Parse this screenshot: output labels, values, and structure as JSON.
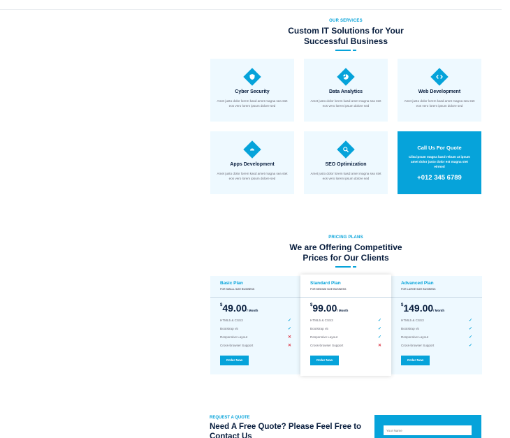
{
  "services": {
    "eyebrow": "OUR SERVICES",
    "heading_line1": "Custom IT Solutions for Your",
    "heading_line2": "Successful Business",
    "items": [
      {
        "title": "Cyber Security",
        "text": "Amet justo dolor lorem kasd amet magna sea stet eos vero lorem ipsum dolore sed",
        "icon": "shield-icon"
      },
      {
        "title": "Data Analytics",
        "text": "Amet justo dolor lorem kasd amet magna sea stet eos vero lorem ipsum dolore sed",
        "icon": "chart-pie-icon"
      },
      {
        "title": "Web Development",
        "text": "Amet justo dolor lorem kasd amet magna sea stet eos vero lorem ipsum dolore sed",
        "icon": "code-icon"
      },
      {
        "title": "Apps Development",
        "text": "Amet justo dolor lorem kasd amet magna sea stet eos vero lorem ipsum dolore sed",
        "icon": "android-icon"
      },
      {
        "title": "SEO Optimization",
        "text": "Amet justo dolor lorem kasd amet magna sea stet eos vero lorem ipsum dolore sed",
        "icon": "search-icon"
      }
    ],
    "quote_card": {
      "title": "Call Us For Quote",
      "text": "Clita ipsum magna kasd rebum at ipsum amet dolor justo dolor est magna stet eirmod",
      "phone": "+012 345 6789"
    }
  },
  "pricing": {
    "eyebrow": "PRICING PLANS",
    "heading_line1": "We are Offering Competitive",
    "heading_line2": "Prices for Our Clients",
    "plans": [
      {
        "name": "Basic Plan",
        "subtitle": "FOR SMALL SIZE BUSINESS",
        "currency": "$",
        "amount": "49.00",
        "period": "/ Month",
        "features": [
          {
            "label": "HTML5 & CSS3",
            "included": true
          },
          {
            "label": "Bootstrap v5",
            "included": true
          },
          {
            "label": "Responsive Layout",
            "included": false
          },
          {
            "label": "Cross-browser Support",
            "included": false
          }
        ],
        "button": "Order Now"
      },
      {
        "name": "Standard Plan",
        "subtitle": "FOR MEDIUM SIZE BUSINESS",
        "currency": "$",
        "amount": "99.00",
        "period": "/ Month",
        "features": [
          {
            "label": "HTML5 & CSS3",
            "included": true
          },
          {
            "label": "Bootstrap v5",
            "included": true
          },
          {
            "label": "Responsive Layout",
            "included": true
          },
          {
            "label": "Cross-browser Support",
            "included": false
          }
        ],
        "button": "Order Now"
      },
      {
        "name": "Advanced Plan",
        "subtitle": "FOR LARGE SIZE BUSINESS",
        "currency": "$",
        "amount": "149.00",
        "period": "/ Month",
        "features": [
          {
            "label": "HTML5 & CSS3",
            "included": true
          },
          {
            "label": "Bootstrap v5",
            "included": true
          },
          {
            "label": "Responsive Layout",
            "included": true
          },
          {
            "label": "Cross-browser Support",
            "included": true
          }
        ],
        "button": "Order Now"
      }
    ]
  },
  "request_quote": {
    "eyebrow": "REQUEST A QUOTE",
    "heading": "Need A Free Quote? Please Feel Free to Contact Us",
    "name_placeholder": "Your Name"
  },
  "colors": {
    "accent": "#06a3da",
    "dark": "#091e3e",
    "card_bg": "#eef9ff",
    "danger": "#dc3545"
  }
}
